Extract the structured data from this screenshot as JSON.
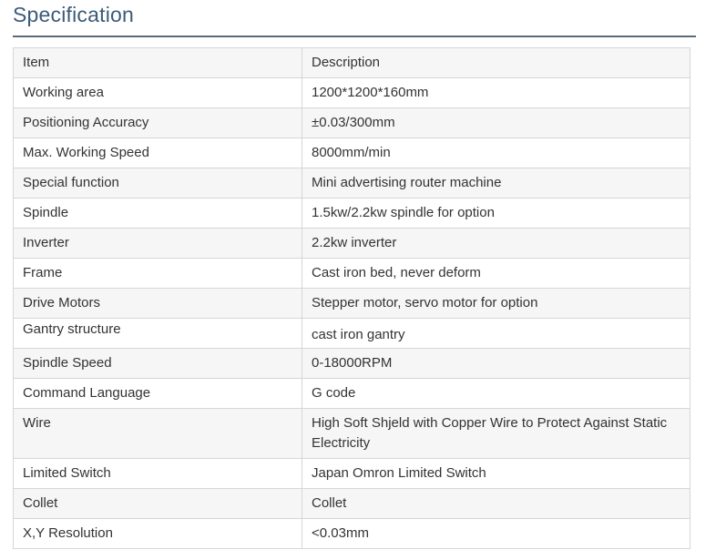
{
  "heading": "Specification",
  "table": {
    "rows": [
      {
        "item": "Item",
        "desc": "Description"
      },
      {
        "item": "Working area",
        "desc": "1200*1200*160mm"
      },
      {
        "item": "Positioning Accuracy",
        "desc": "±0.03/300mm"
      },
      {
        "item": "Max. Working Speed",
        "desc": "8000mm/min"
      },
      {
        "item": "Special function",
        "desc": "Mini advertising router machine"
      },
      {
        "item": "Spindle",
        "desc": "1.5kw/2.2kw spindle for option"
      },
      {
        "item": "Inverter",
        "desc": "2.2kw inverter"
      },
      {
        "item": "Frame",
        "desc": "Cast iron bed, never deform"
      },
      {
        "item": "Drive Motors",
        "desc": "Stepper motor, servo motor for option"
      },
      {
        "item": "Gantry structure",
        "desc": "cast iron gantry"
      },
      {
        "item": "Spindle Speed",
        "desc": "0-18000RPM"
      },
      {
        "item": "Command Language",
        "desc": "G code"
      },
      {
        "item": "Wire",
        "desc": "High Soft Shjeld with Copper Wire to Protect Against Static Electricity"
      },
      {
        "item": "Limited Switch",
        "desc": "Japan Omron Limited Switch"
      },
      {
        "item": "Collet",
        "desc": "Collet"
      },
      {
        "item": "X,Y Resolution",
        "desc": "<0.03mm"
      }
    ]
  }
}
